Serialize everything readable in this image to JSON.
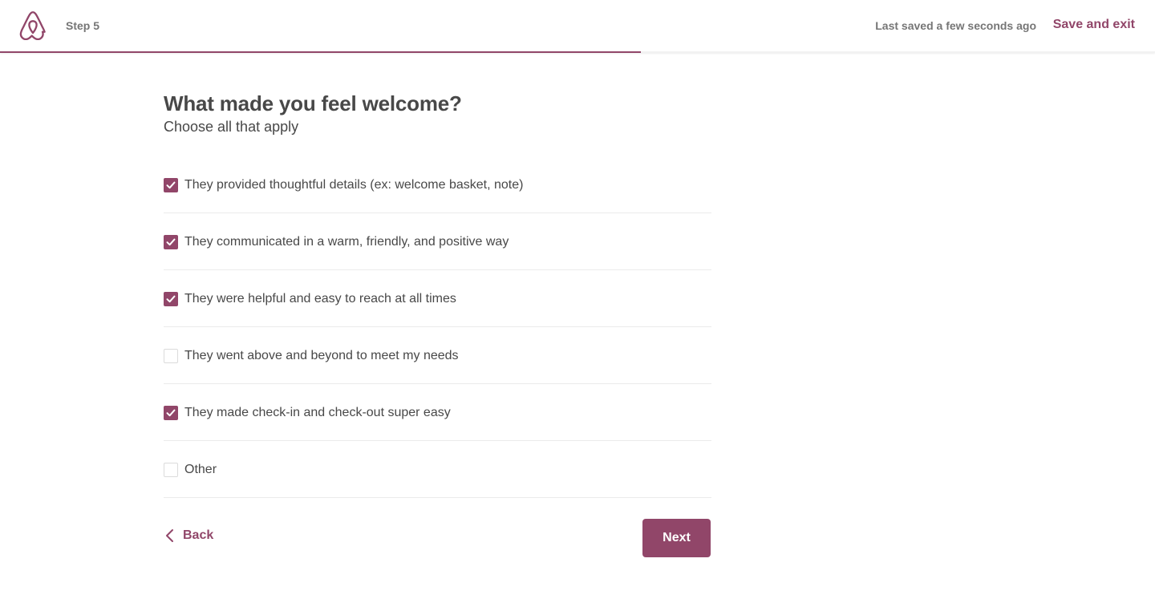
{
  "header": {
    "step": "Step 5",
    "last_saved": "Last saved a few seconds ago",
    "save_exit": "Save and exit",
    "progress_fraction": 0.555
  },
  "colors": {
    "brand": "#914669",
    "text": "#484848",
    "muted": "#767676",
    "divider": "#ebebeb"
  },
  "question": {
    "title": "What made you feel welcome?",
    "subtitle": "Choose all that apply"
  },
  "options": [
    {
      "label": "They provided thoughtful details (ex: welcome basket, note)",
      "checked": true
    },
    {
      "label": "They communicated in a warm, friendly, and positive way",
      "checked": true
    },
    {
      "label": "They were helpful and easy to reach at all times",
      "checked": true
    },
    {
      "label": "They went above and beyond to meet my needs",
      "checked": false
    },
    {
      "label": "They made check-in and check-out super easy",
      "checked": true
    },
    {
      "label": "Other",
      "checked": false
    }
  ],
  "footer": {
    "back_label": "Back",
    "next_label": "Next"
  }
}
